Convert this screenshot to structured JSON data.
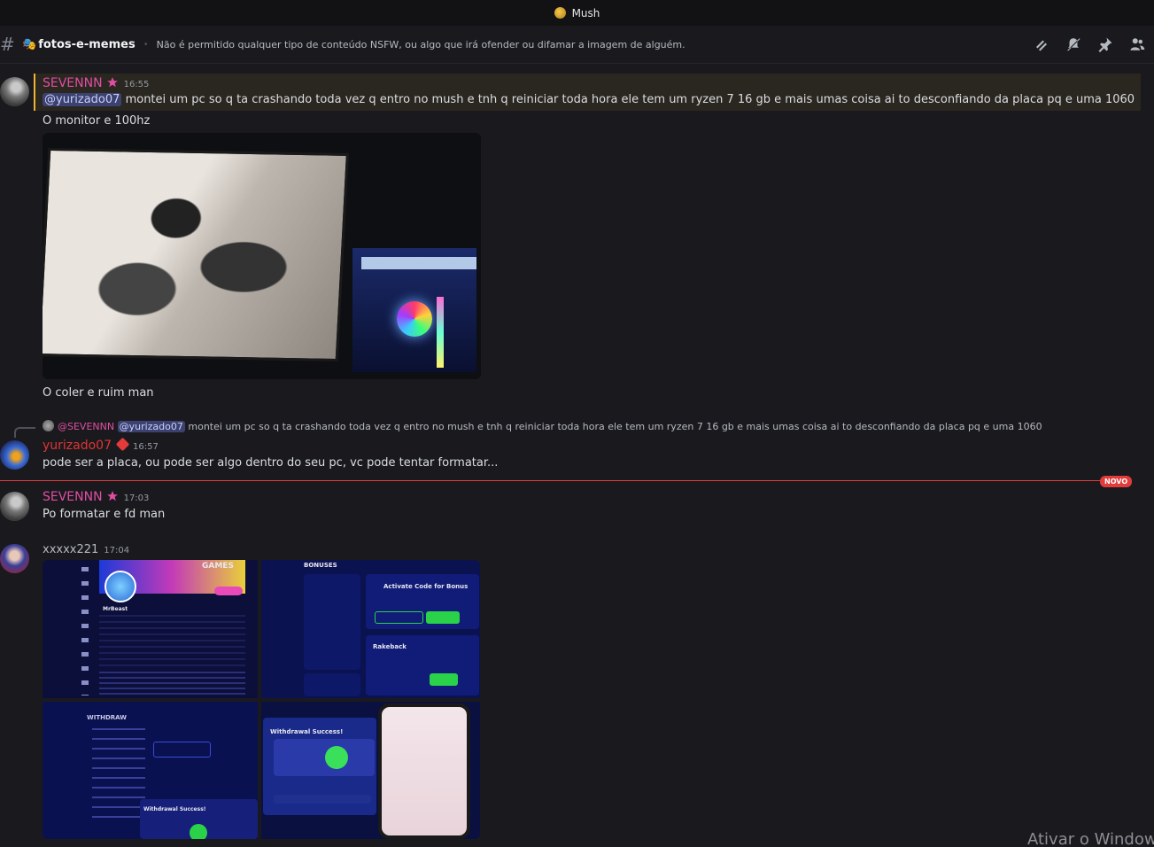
{
  "window": {
    "title": "Mush"
  },
  "channel": {
    "emoji": "🎭",
    "name": "fotos-e-memes",
    "topic": "Não é permitido qualquer tipo de conteúdo NSFW, ou algo que irá ofender ou difamar a imagem de alguém."
  },
  "toolbar": {
    "icons": [
      "threads-icon",
      "mute-icon",
      "pin-icon",
      "members-icon"
    ]
  },
  "messages": [
    {
      "author": "SEVENNN",
      "time": "16:55",
      "mention": "@yurizado07",
      "text": "montei um pc so q ta crashando toda vez q entro no mush  e tnh q reiniciar toda hora ele tem um ryzen 7 16 gb e mais umas coisa ai to desconfiando da placa pq e uma 1060",
      "followups": [
        "O monitor e 100hz",
        "O coler e ruim man"
      ]
    },
    {
      "reply_to_author": "@SEVENNN",
      "reply_to_mention": "@yurizado07",
      "reply_to_text": "montei um pc so q ta crashando toda vez q entro no mush  e tnh q reiniciar toda hora ele tem um ryzen 7 16 gb e mais umas coisa ai to desconfiando da placa pq e uma 1060",
      "author": "yurizado07",
      "time": "16:57",
      "text": "pode ser a placa, ou pode ser algo dentro do seu pc, vc pode tentar formatar..."
    },
    {
      "author": "SEVENNN",
      "time": "17:03",
      "text": "Po formatar e fd man"
    },
    {
      "author": "xxxxx221",
      "time": "17:04"
    }
  ],
  "divider": {
    "label": "NOVO"
  },
  "screenshots": {
    "bonuses_title": "BONUSES",
    "activate_title": "Activate Code for Bonus",
    "rakeback_title": "Rakeback",
    "withdraw_title": "WITHDRAW",
    "withdraw_success": "Withdrawal Success!",
    "games_title": "GAMES",
    "profile_name": "MrBeast"
  },
  "watermark": "Ativar o Window",
  "colors": {
    "accent_name": "#e04ea2",
    "mention_bg": "#3c4270",
    "new_divider": "#e23b3b"
  }
}
